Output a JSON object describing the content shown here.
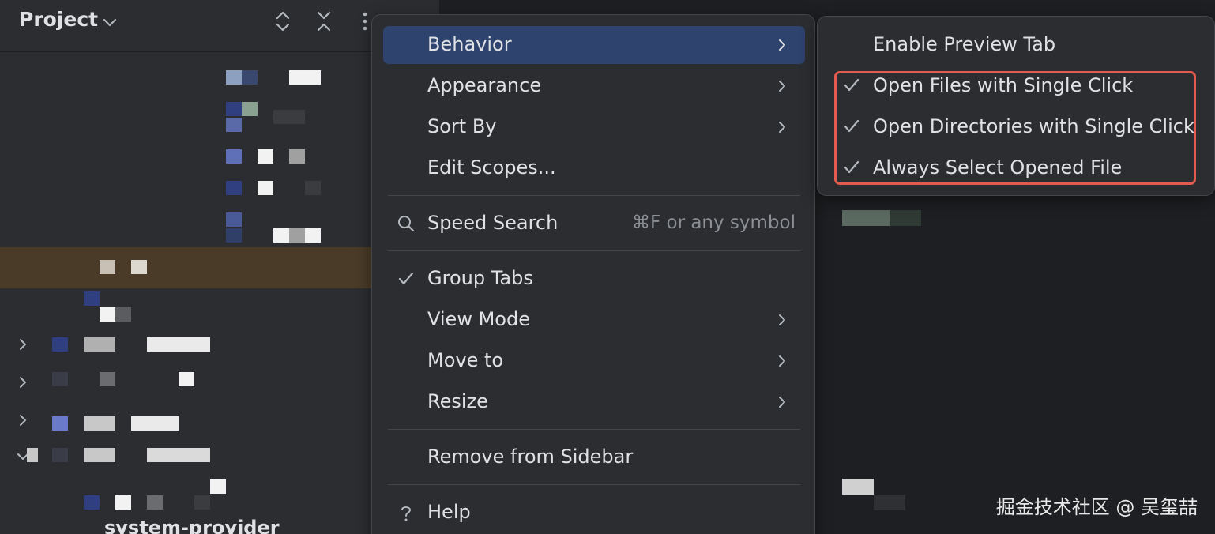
{
  "project_panel": {
    "title": "Project",
    "icons": [
      "chevron-down-icon",
      "expand-all-icon",
      "collapse-all-icon",
      "more-options-icon"
    ],
    "tree_visible_label": "system-provider"
  },
  "context_menu": {
    "items": [
      {
        "label": "Behavior",
        "has_submenu": true,
        "selected": true
      },
      {
        "label": "Appearance",
        "has_submenu": true
      },
      {
        "label": "Sort By",
        "has_submenu": true
      },
      {
        "label": "Edit Scopes..."
      },
      {
        "label": "Speed Search",
        "shortcut": "⌘F or any symbol",
        "icon": "search-icon"
      },
      {
        "label": "Group Tabs",
        "checked": true
      },
      {
        "label": "View Mode",
        "has_submenu": true
      },
      {
        "label": "Move to",
        "has_submenu": true
      },
      {
        "label": "Resize",
        "has_submenu": true
      },
      {
        "label": "Remove from Sidebar"
      },
      {
        "label": "Help",
        "icon": "help-icon"
      }
    ]
  },
  "submenu": {
    "items": [
      {
        "label": "Enable Preview Tab",
        "checked": false
      },
      {
        "label": "Open Files with Single Click",
        "checked": true
      },
      {
        "label": "Open Directories with Single Click",
        "checked": true
      },
      {
        "label": "Always Select Opened File",
        "checked": true
      }
    ]
  },
  "watermark": "掘金技术社区 @ 吴玺喆",
  "colors": {
    "background": "#2b2d30",
    "editor_background": "#1e1f22",
    "selection": "#2e436e",
    "highlight_box": "#e55a4e",
    "text": "#dfe1e5",
    "muted_text": "#8c8f94"
  }
}
